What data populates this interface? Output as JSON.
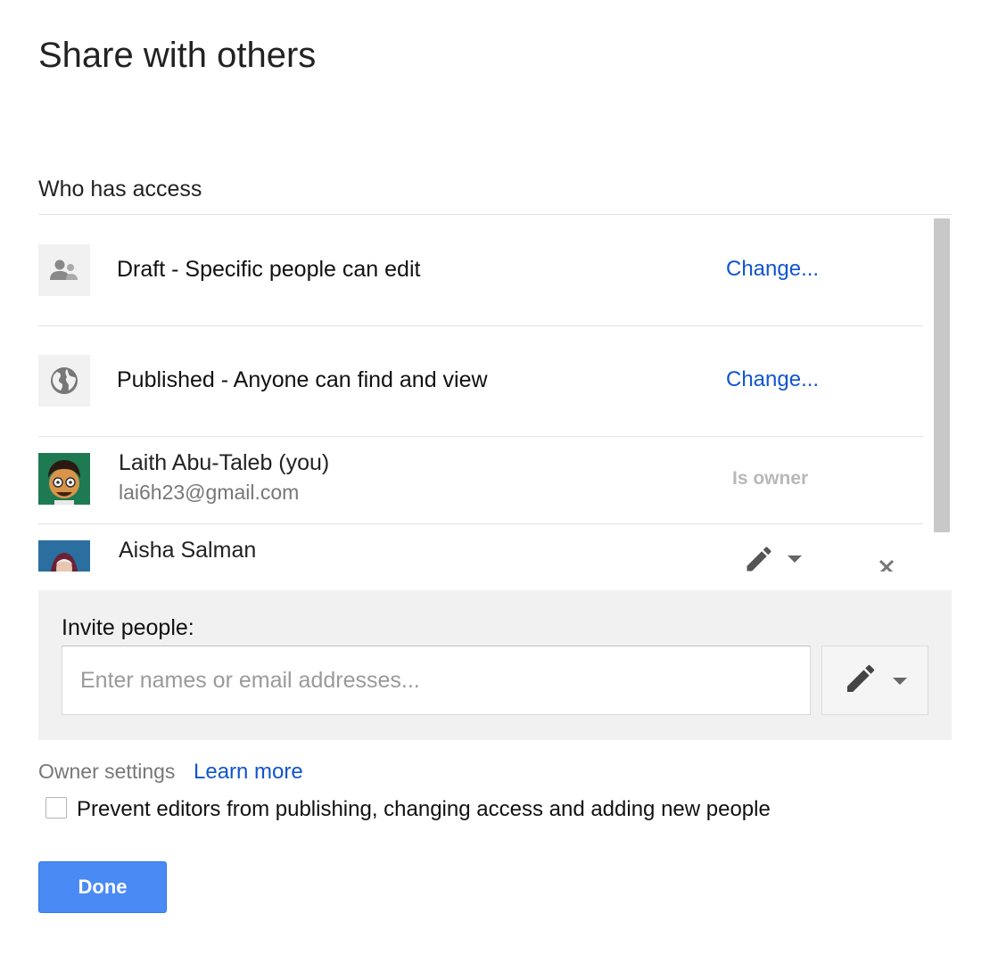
{
  "dialog": {
    "title": "Share with others",
    "who_has_access_label": "Who has access"
  },
  "access": {
    "draft": {
      "icon": "people-icon",
      "text": "Draft - Specific people can edit",
      "action": "Change..."
    },
    "published": {
      "icon": "globe-icon",
      "text": "Published - Anyone can find and view",
      "action": "Change..."
    }
  },
  "people": [
    {
      "name": "Laith Abu-Taleb (you)",
      "email": "lai6h23@gmail.com",
      "role": "Is owner"
    },
    {
      "name": "Aisha Salman",
      "permission_icon": "pencil-icon",
      "remove_icon": "close-icon"
    }
  ],
  "invite": {
    "label": "Invite people:",
    "placeholder": "Enter names or email addresses...",
    "permission_icon": "pencil-icon"
  },
  "owner_settings": {
    "label": "Owner settings",
    "learn_more": "Learn more",
    "checkbox_label": "Prevent editors from publishing, changing access and adding new people",
    "checkbox_checked": false
  },
  "buttons": {
    "done": "Done"
  },
  "colors": {
    "link": "#1155cc",
    "primary_button": "#4a8af4",
    "panel_bg": "#f1f1f1"
  }
}
